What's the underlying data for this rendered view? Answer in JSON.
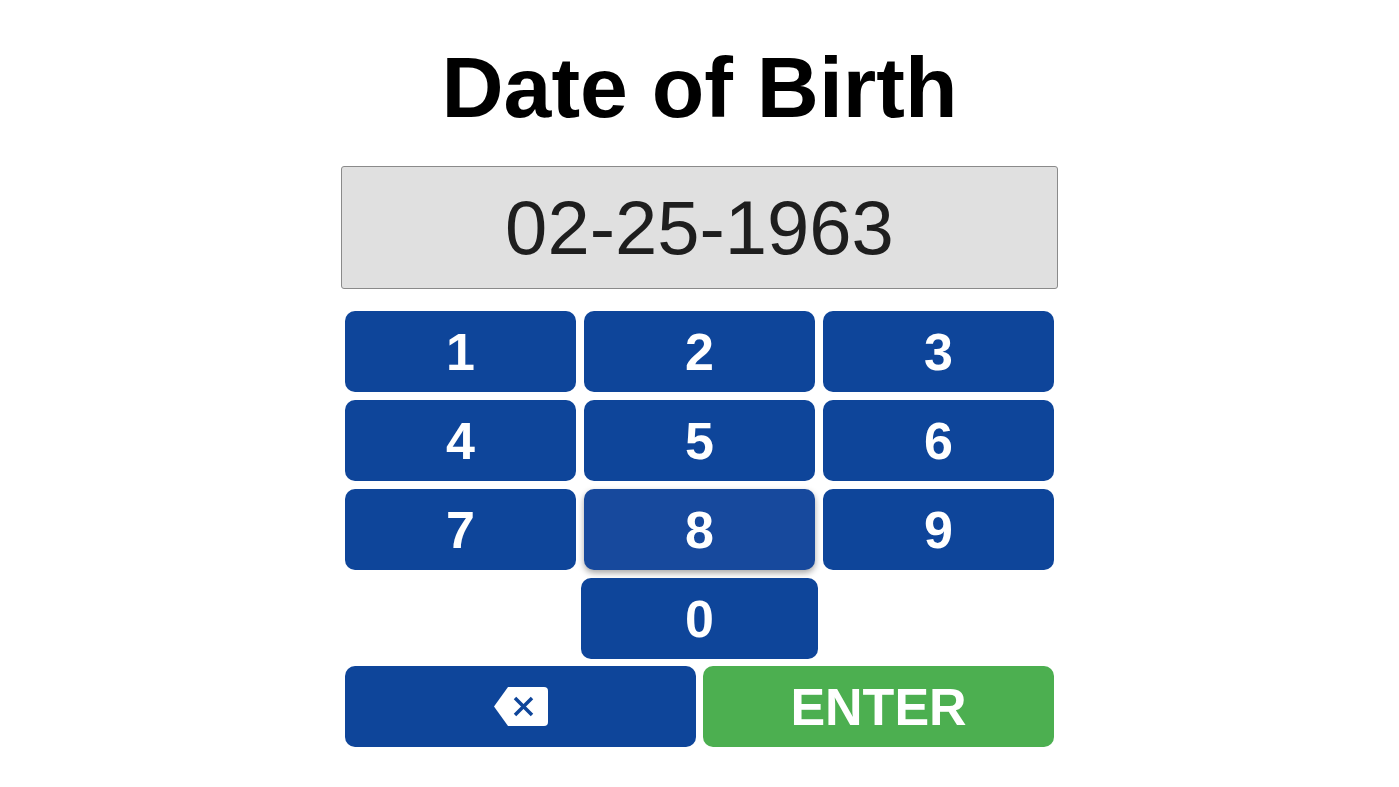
{
  "title": "Date of Birth",
  "display": {
    "value": "02-25-1963"
  },
  "keys": [
    {
      "label": "1",
      "hovered": false
    },
    {
      "label": "2",
      "hovered": false
    },
    {
      "label": "3",
      "hovered": false
    },
    {
      "label": "4",
      "hovered": false
    },
    {
      "label": "5",
      "hovered": false
    },
    {
      "label": "6",
      "hovered": false
    },
    {
      "label": "7",
      "hovered": false
    },
    {
      "label": "8",
      "hovered": true
    },
    {
      "label": "9",
      "hovered": false
    },
    {
      "label": "0",
      "hovered": false
    }
  ],
  "actions": [
    {
      "kind": "backspace"
    },
    {
      "kind": "enter",
      "label": "ENTER"
    }
  ]
}
